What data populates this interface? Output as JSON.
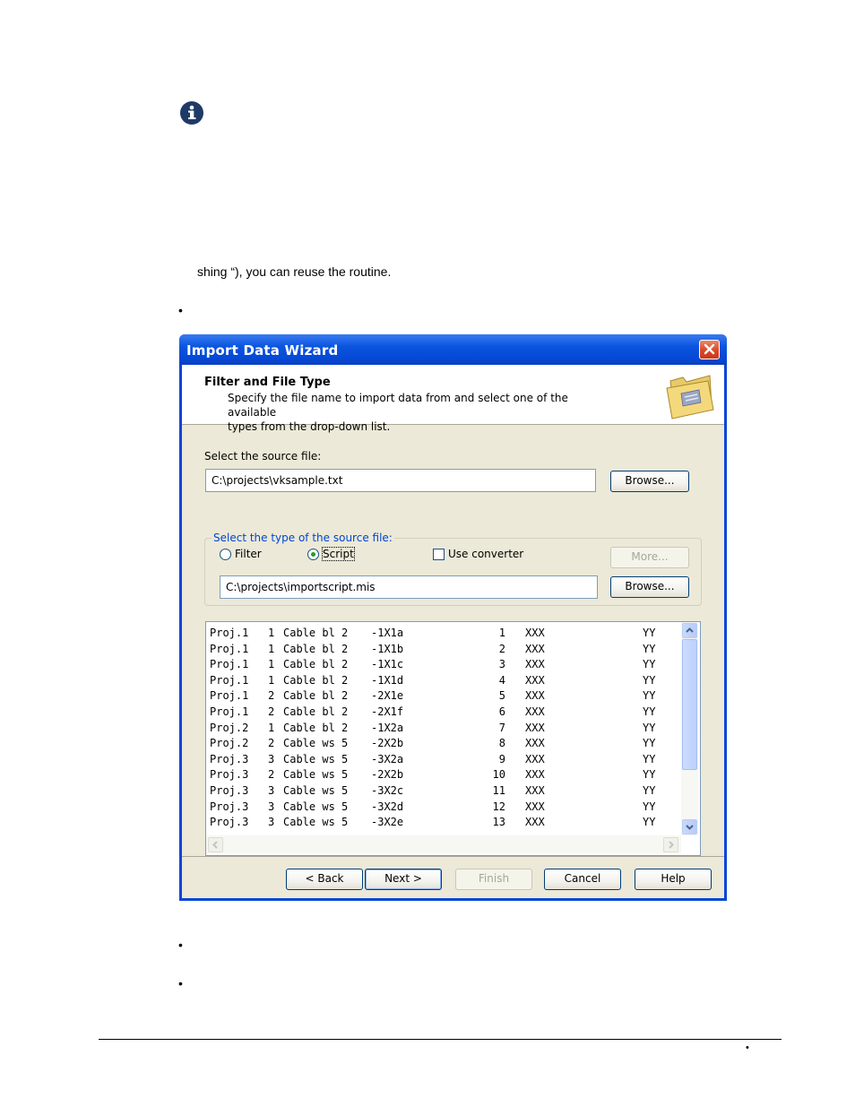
{
  "document": {
    "text_line": "shing “), you can reuse the routine.",
    "bullets": [
      "•",
      "•",
      "•"
    ],
    "footer_bullet": "•",
    "info_icon": "info-icon"
  },
  "dialog": {
    "title": "Import Data Wizard",
    "header": {
      "title": "Filter and File Type",
      "description_line1": "Specify the file name to import data from and select one of the available",
      "description_line2": "types from the drop-down list.",
      "icon": "folder-icon"
    },
    "source_label": "Select the source file:",
    "source_value": "C:\\projects\\vksample.txt",
    "browse1": "Browse...",
    "type_group_label": "Select the type of the source file:",
    "radio_filter": "Filter",
    "radio_script": "Script",
    "selected_type": "Script",
    "use_converter": "Use converter",
    "more": "More...",
    "script_value": "C:\\projects\\importscript.mis",
    "browse2": "Browse...",
    "preview_rows": [
      [
        "Proj.1",
        "1",
        "Cable bl 2",
        "-1X1a",
        "1",
        "XXX",
        "YY"
      ],
      [
        "Proj.1",
        "1",
        "Cable bl 2",
        "-1X1b",
        "2",
        "XXX",
        "YY"
      ],
      [
        "Proj.1",
        "1",
        "Cable bl 2",
        "-1X1c",
        "3",
        "XXX",
        "YY"
      ],
      [
        "Proj.1",
        "1",
        "Cable bl 2",
        "-1X1d",
        "4",
        "XXX",
        "YY"
      ],
      [
        "Proj.1",
        "2",
        "Cable bl 2",
        "-2X1e",
        "5",
        "XXX",
        "YY"
      ],
      [
        "Proj.1",
        "2",
        "Cable bl 2",
        "-2X1f",
        "6",
        "XXX",
        "YY"
      ],
      [
        "Proj.2",
        "1",
        "Cable bl 2",
        "-1X2a",
        "7",
        "XXX",
        "YY"
      ],
      [
        "Proj.2",
        "2",
        "Cable ws 5",
        "-2X2b",
        "8",
        "XXX",
        "YY"
      ],
      [
        "Proj.3",
        "3",
        "Cable ws 5",
        "-3X2a",
        "9",
        "XXX",
        "YY"
      ],
      [
        "Proj.3",
        "2",
        "Cable ws 5",
        "-2X2b",
        "10",
        "XXX",
        "YY"
      ],
      [
        "Proj.3",
        "3",
        "Cable ws 5",
        "-3X2c",
        "11",
        "XXX",
        "YY"
      ],
      [
        "Proj.3",
        "3",
        "Cable ws 5",
        "-3X2d",
        "12",
        "XXX",
        "YY"
      ],
      [
        "Proj.3",
        "3",
        "Cable ws 5",
        "-3X2e",
        "13",
        "XXX",
        "YY"
      ]
    ],
    "buttons": {
      "back": "< Back",
      "next": "Next >",
      "finish": "Finish",
      "cancel": "Cancel",
      "help": "Help"
    },
    "colors": {
      "title_bar": "#0a55e0",
      "group_title": "#0046d5",
      "client_bg": "#ece9d8"
    }
  }
}
